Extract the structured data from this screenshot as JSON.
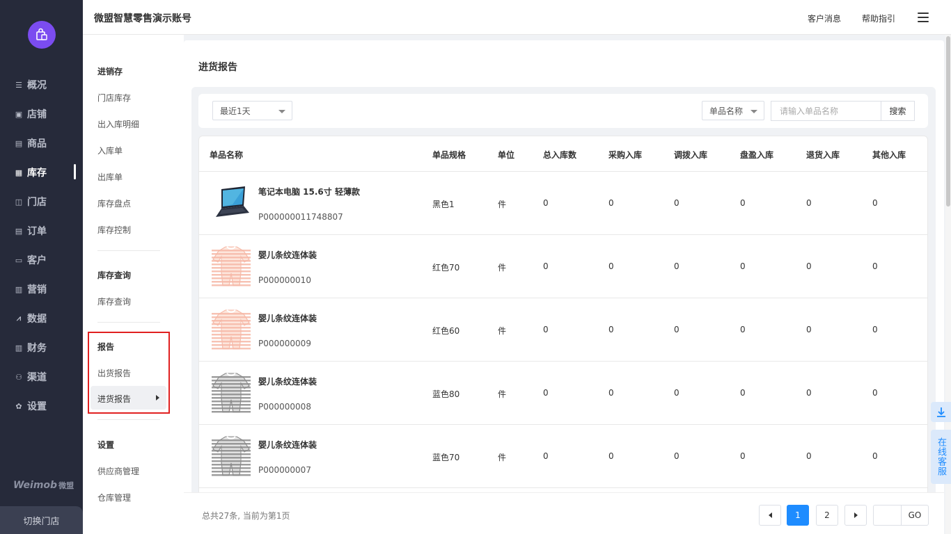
{
  "nav": {
    "items": [
      {
        "label": "概况",
        "icon": "list-icon",
        "glyph": "☰"
      },
      {
        "label": "店铺",
        "icon": "shop-icon",
        "glyph": "▣"
      },
      {
        "label": "商品",
        "icon": "goods-icon",
        "glyph": "▤"
      },
      {
        "label": "库存",
        "icon": "grid-icon",
        "glyph": "▦"
      },
      {
        "label": "门店",
        "icon": "store-icon",
        "glyph": "◫"
      },
      {
        "label": "订单",
        "icon": "order-icon",
        "glyph": "▤"
      },
      {
        "label": "客户",
        "icon": "customer-icon",
        "glyph": "▭"
      },
      {
        "label": "营销",
        "icon": "bar-chart-icon",
        "glyph": "▥"
      },
      {
        "label": "数据",
        "icon": "line-chart-icon",
        "glyph": "⩘"
      },
      {
        "label": "财务",
        "icon": "finance-icon",
        "glyph": "▥"
      },
      {
        "label": "渠道",
        "icon": "channel-icon",
        "glyph": "⚇"
      },
      {
        "label": "设置",
        "icon": "settings-icon",
        "glyph": "✿"
      }
    ],
    "active_index": 3,
    "brand": "Weimob",
    "brand_cn": "微盟",
    "switch_store": "切换门店"
  },
  "header": {
    "title": "微盟智慧零售演示账号",
    "customer_msg": "客户消息",
    "help": "帮助指引"
  },
  "submenu": {
    "sections": [
      {
        "title": "进销存",
        "items": [
          "门店库存",
          "出入库明细",
          "入库单",
          "出库单",
          "库存盘点",
          "库存控制"
        ]
      },
      {
        "title": "库存查询",
        "items": [
          "库存查询"
        ]
      },
      {
        "title": "报告",
        "items": [
          "出货报告"
        ],
        "active": "进货报告"
      },
      {
        "title": "设置",
        "items": [
          "供应商管理",
          "仓库管理"
        ]
      }
    ]
  },
  "main": {
    "title": "进货报告",
    "filters": {
      "date_range": "最近1天",
      "field_select": "单品名称",
      "search_placeholder": "请输入单品名称",
      "search_button": "搜索"
    },
    "columns": [
      "单品名称",
      "单品规格",
      "单位",
      "总入库数",
      "采购入库",
      "调拨入库",
      "盘盈入库",
      "退货入库",
      "其他入库"
    ],
    "rows": [
      {
        "name": "笔记本电脑 15.6寸 轻薄款",
        "code": "P000000011748807",
        "spec": "黑色1",
        "unit": "件",
        "total": "0",
        "purchase": "0",
        "transfer": "0",
        "surplus": "0",
        "return": "0",
        "other": "0",
        "thumb": "laptop"
      },
      {
        "name": "婴儿条纹连体装",
        "code": "P000000010",
        "spec": "红色70",
        "unit": "件",
        "total": "0",
        "purchase": "0",
        "transfer": "0",
        "surplus": "0",
        "return": "0",
        "other": "0",
        "thumb": "onesie-pink"
      },
      {
        "name": "婴儿条纹连体装",
        "code": "P000000009",
        "spec": "红色60",
        "unit": "件",
        "total": "0",
        "purchase": "0",
        "transfer": "0",
        "surplus": "0",
        "return": "0",
        "other": "0",
        "thumb": "onesie-pink"
      },
      {
        "name": "婴儿条纹连体装",
        "code": "P000000008",
        "spec": "蓝色80",
        "unit": "件",
        "total": "0",
        "purchase": "0",
        "transfer": "0",
        "surplus": "0",
        "return": "0",
        "other": "0",
        "thumb": "onesie-gray"
      },
      {
        "name": "婴儿条纹连体装",
        "code": "P000000007",
        "spec": "蓝色70",
        "unit": "件",
        "total": "0",
        "purchase": "0",
        "transfer": "0",
        "surplus": "0",
        "return": "0",
        "other": "0",
        "thumb": "onesie-gray"
      }
    ]
  },
  "pagination": {
    "summary": "总共27条, 当前为第1页",
    "pages": [
      "1",
      "2"
    ],
    "current": "1",
    "go": "GO"
  },
  "floating": {
    "service": "在线客服"
  },
  "colors": {
    "nav_bg": "#262a3a",
    "accent": "#1e8cff",
    "logo": "#7b4cf0",
    "highlight": "#e02020"
  }
}
